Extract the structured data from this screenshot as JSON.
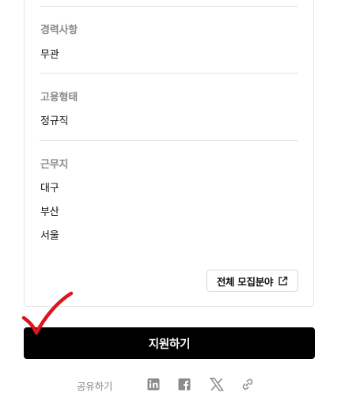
{
  "sections": [
    {
      "label": "경력사항",
      "values": [
        "무관"
      ]
    },
    {
      "label": "고용형태",
      "values": [
        "정규직"
      ]
    },
    {
      "label": "근무지",
      "values": [
        "대구",
        "부산",
        "서울"
      ]
    }
  ],
  "all_fields_button": {
    "label": "전체 모집분야",
    "icon": "external-link-icon"
  },
  "apply_button": {
    "label": "지원하기"
  },
  "share": {
    "label": "공유하기",
    "icons": [
      "linkedin-icon",
      "facebook-icon",
      "x-icon",
      "link-icon"
    ]
  },
  "colors": {
    "primary_button": "#000000",
    "label_gray": "#8a8a8a",
    "annotation_red": "#e0141e"
  }
}
